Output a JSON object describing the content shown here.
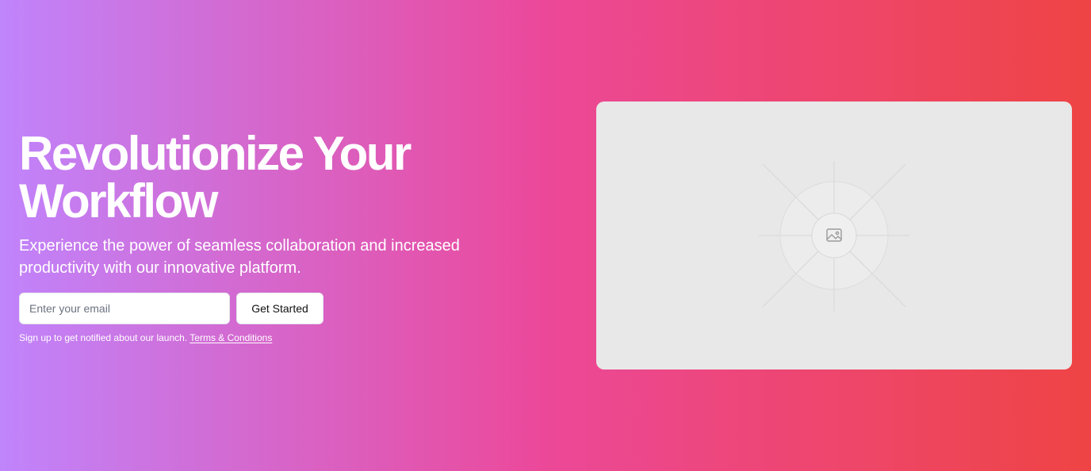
{
  "hero": {
    "title_line1": "Revolutionize Your",
    "title_line2": "Workflow",
    "subtitle": "Experience the power of seamless collaboration and increased productivity with our innovative platform."
  },
  "signup": {
    "email_placeholder": "Enter your email",
    "button_label": "Get Started",
    "note_text": "Sign up to get notified about our launch. ",
    "terms_link": "Terms & Conditions"
  },
  "media": {
    "icon": "image-icon"
  },
  "colors": {
    "gradient_start": "#c084fc",
    "gradient_mid": "#ec4899",
    "gradient_end": "#ef4444",
    "placeholder_bg": "#e8e8e8"
  }
}
